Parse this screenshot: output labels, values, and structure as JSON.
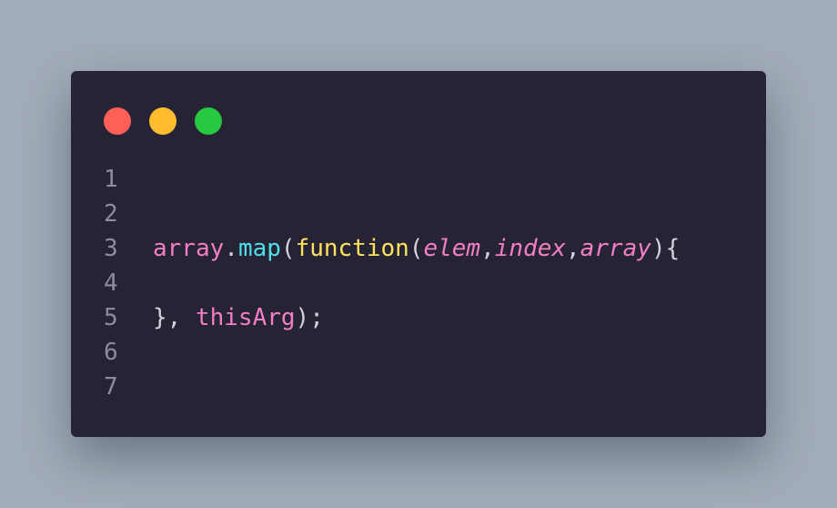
{
  "window": {
    "controls": [
      {
        "name": "close",
        "color": "#ff5f57"
      },
      {
        "name": "minimize",
        "color": "#febc2e"
      },
      {
        "name": "maximize",
        "color": "#28c840"
      }
    ]
  },
  "code": {
    "line_numbers": [
      "1",
      "2",
      "3",
      "4",
      "5",
      "6",
      "7"
    ],
    "line3": {
      "t1": "array",
      "t2": ".",
      "t3": "map",
      "t4": "(",
      "t5": "function",
      "t6": "(",
      "t7": "elem",
      "t8": ",",
      "t9": "index",
      "t10": ",",
      "t11": "array",
      "t12": "){"
    },
    "line5": {
      "t1": "}, ",
      "t2": "thisArg",
      "t3": ");"
    }
  },
  "colors": {
    "page_background": "#a3adb9",
    "editor_background": "#262335",
    "line_number": "#8e8b9c",
    "variable": "#f27ec5",
    "method": "#4ee0ea",
    "keyword": "#fee25e",
    "punctuation": "#d4d0e0"
  }
}
